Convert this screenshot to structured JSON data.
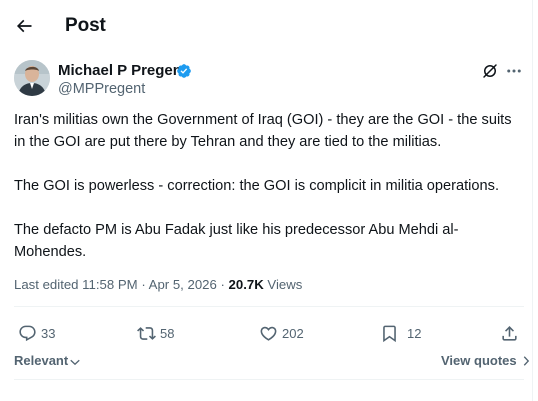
{
  "header": {
    "title": "Post",
    "back_icon": "arrow-left-icon"
  },
  "author": {
    "name": "Michael P Pregent",
    "handle": "@MPPregent",
    "verified": true,
    "verified_color": "#1d9bf0"
  },
  "post": {
    "paragraphs": [
      "Iran's militias own the Government of Iraq (GOI) - they are the GOI - the suits in the GOI are put there by Tehran and they are tied to the militias.",
      "The GOI is powerless - correction: the GOI is complicit in militia operations.",
      "The defacto PM is Abu Fadak just like his predecessor Abu Mehdi al-Mohendes."
    ],
    "edited_label": "Last edited 11:58 PM · Apr 5, 2026 · ",
    "views_count": "20.7K",
    "views_label": " Views"
  },
  "actions": {
    "replies": "33",
    "reposts": "58",
    "likes": "202",
    "bookmarks": "12"
  },
  "footer": {
    "sort_label": "Relevant",
    "view_quotes_label": "View quotes"
  },
  "colors": {
    "text": "#0f1419",
    "secondary": "#536471",
    "divider": "#eff3f4"
  }
}
